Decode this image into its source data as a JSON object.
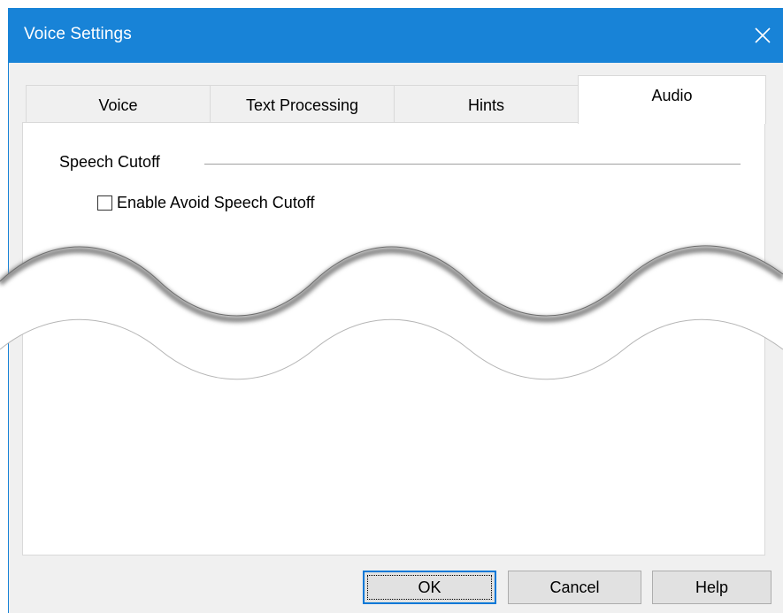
{
  "window": {
    "title": "Voice Settings",
    "close_icon": "close-icon",
    "accent_color": "#1883d7"
  },
  "tabs": [
    {
      "label": "Voice",
      "selected": false
    },
    {
      "label": "Text Processing",
      "selected": false
    },
    {
      "label": "Hints",
      "selected": false
    },
    {
      "label": "Audio",
      "selected": true
    }
  ],
  "audio_tab": {
    "group_label": "Speech Cutoff",
    "checkbox_label": "Enable Avoid Speech Cutoff",
    "checkbox_checked": false
  },
  "buttons": {
    "ok": "OK",
    "cancel": "Cancel",
    "help": "Help"
  }
}
